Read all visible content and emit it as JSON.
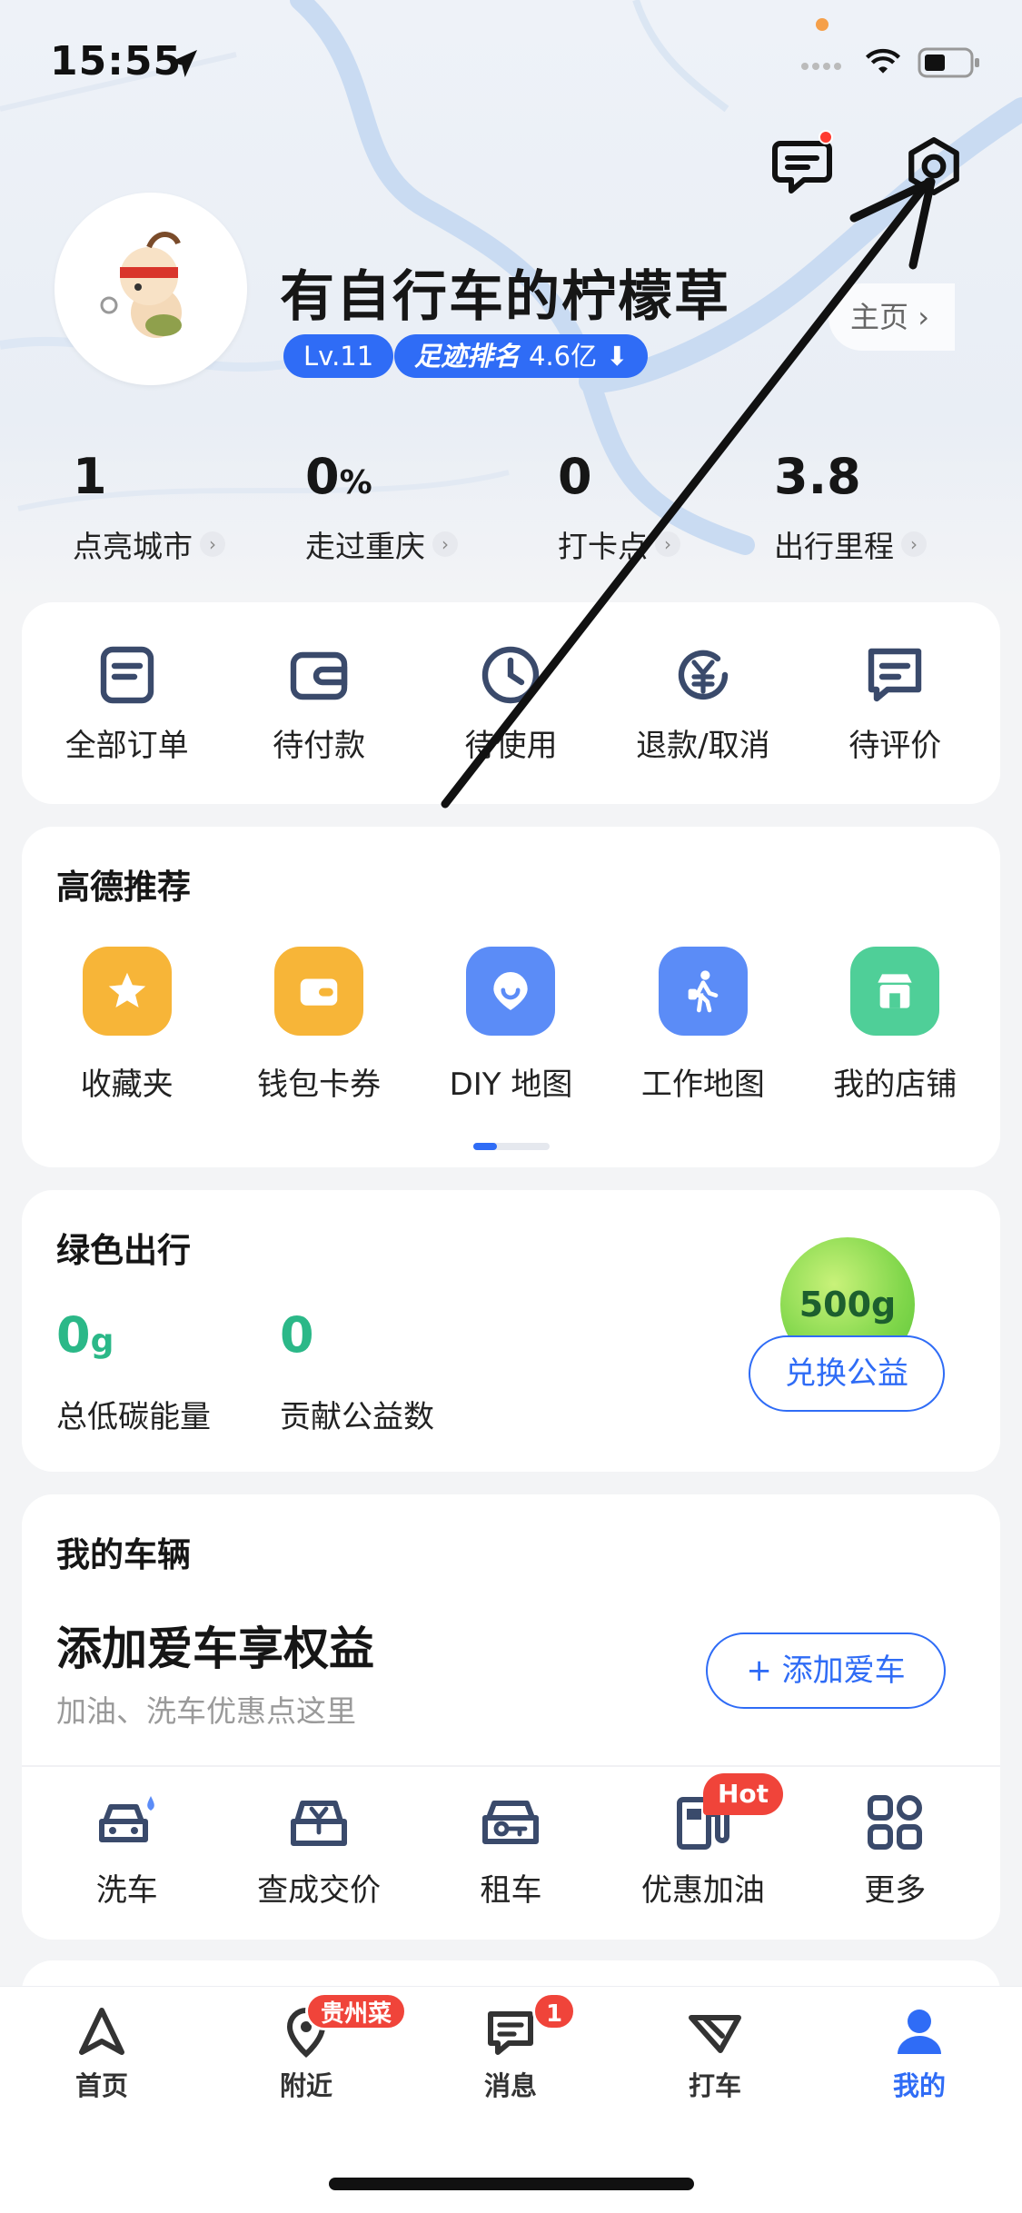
{
  "status_bar": {
    "time": "15:55"
  },
  "profile": {
    "username": "有自行车的柠檬草",
    "level": "Lv.11",
    "rank_label": "足迹排名",
    "rank_value": "4.6亿",
    "home_link": "主页"
  },
  "stats": [
    {
      "num": "1",
      "unit": "",
      "label": "点亮城市"
    },
    {
      "num": "0",
      "unit": "%",
      "label": "走过重庆"
    },
    {
      "num": "0",
      "unit": "",
      "label": "打卡点"
    },
    {
      "num": "3.8",
      "unit": "",
      "label": "出行里程"
    }
  ],
  "orders": [
    {
      "label": "全部订单",
      "icon": "order-list-icon"
    },
    {
      "label": "待付款",
      "icon": "wallet-icon"
    },
    {
      "label": "待使用",
      "icon": "clock-icon"
    },
    {
      "label": "退款/取消",
      "icon": "refund-yen-icon"
    },
    {
      "label": "待评价",
      "icon": "review-icon"
    }
  ],
  "gaode_recommend": {
    "title": "高德推荐",
    "items": [
      {
        "label": "收藏夹",
        "icon": "star-icon",
        "color": "#f7b538"
      },
      {
        "label": "钱包卡券",
        "icon": "wallet-card-icon",
        "color": "#f7b538"
      },
      {
        "label": "DIY 地图",
        "icon": "diy-map-icon",
        "color": "#5b8cf7"
      },
      {
        "label": "工作地图",
        "icon": "work-map-icon",
        "color": "#5b8cf7"
      },
      {
        "label": "我的店铺",
        "icon": "shop-icon",
        "color": "#4fcf98"
      }
    ]
  },
  "green_travel": {
    "title": "绿色出行",
    "energy_value": "0",
    "energy_unit": "g",
    "energy_label": "总低碳能量",
    "donate_value": "0",
    "donate_label": "贡献公益数",
    "ball_text": "500g",
    "exchange_button": "兑换公益"
  },
  "vehicle": {
    "title": "我的车辆",
    "headline": "添加爱车享权益",
    "subtitle": "加油、洗车优惠点这里",
    "add_button": "+ 添加爱车",
    "hot_badge": "Hot",
    "services": [
      {
        "label": "洗车",
        "icon": "car-wash-icon"
      },
      {
        "label": "查成交价",
        "icon": "price-yen-icon"
      },
      {
        "label": "租车",
        "icon": "car-rental-icon"
      },
      {
        "label": "优惠加油",
        "icon": "fuel-icon"
      },
      {
        "label": "更多",
        "icon": "grid-more-icon"
      }
    ]
  },
  "tabbar": {
    "tabs": [
      {
        "label": "首页",
        "icon": "navigate-icon"
      },
      {
        "label": "附近",
        "icon": "location-pin-icon",
        "badge": "贵州菜"
      },
      {
        "label": "消息",
        "icon": "message-icon",
        "badge": "1"
      },
      {
        "label": "打车",
        "icon": "taxi-icon"
      },
      {
        "label": "我的",
        "icon": "user-icon"
      }
    ]
  },
  "colors": {
    "accent": "#2f6cf6",
    "green": "#2bb888",
    "badge_red": "#f0443a"
  }
}
